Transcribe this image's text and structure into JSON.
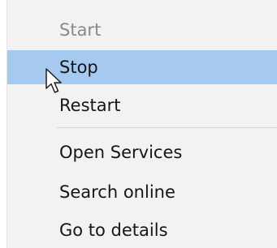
{
  "context_menu": {
    "items": [
      {
        "label": "Start",
        "state": "disabled"
      },
      {
        "label": "Stop",
        "state": "highlighted"
      },
      {
        "label": "Restart",
        "state": "normal"
      },
      {
        "label": "Open Services",
        "state": "normal"
      },
      {
        "label": "Search online",
        "state": "normal"
      },
      {
        "label": "Go to details",
        "state": "normal"
      }
    ]
  },
  "colors": {
    "menu_background": "#f2f2f2",
    "highlight": "#a6c9ef",
    "text": "#161616",
    "disabled_text": "#8a8a8a",
    "separator": "#d6d6d6"
  },
  "cursor": {
    "icon": "arrow-pointer-icon"
  }
}
